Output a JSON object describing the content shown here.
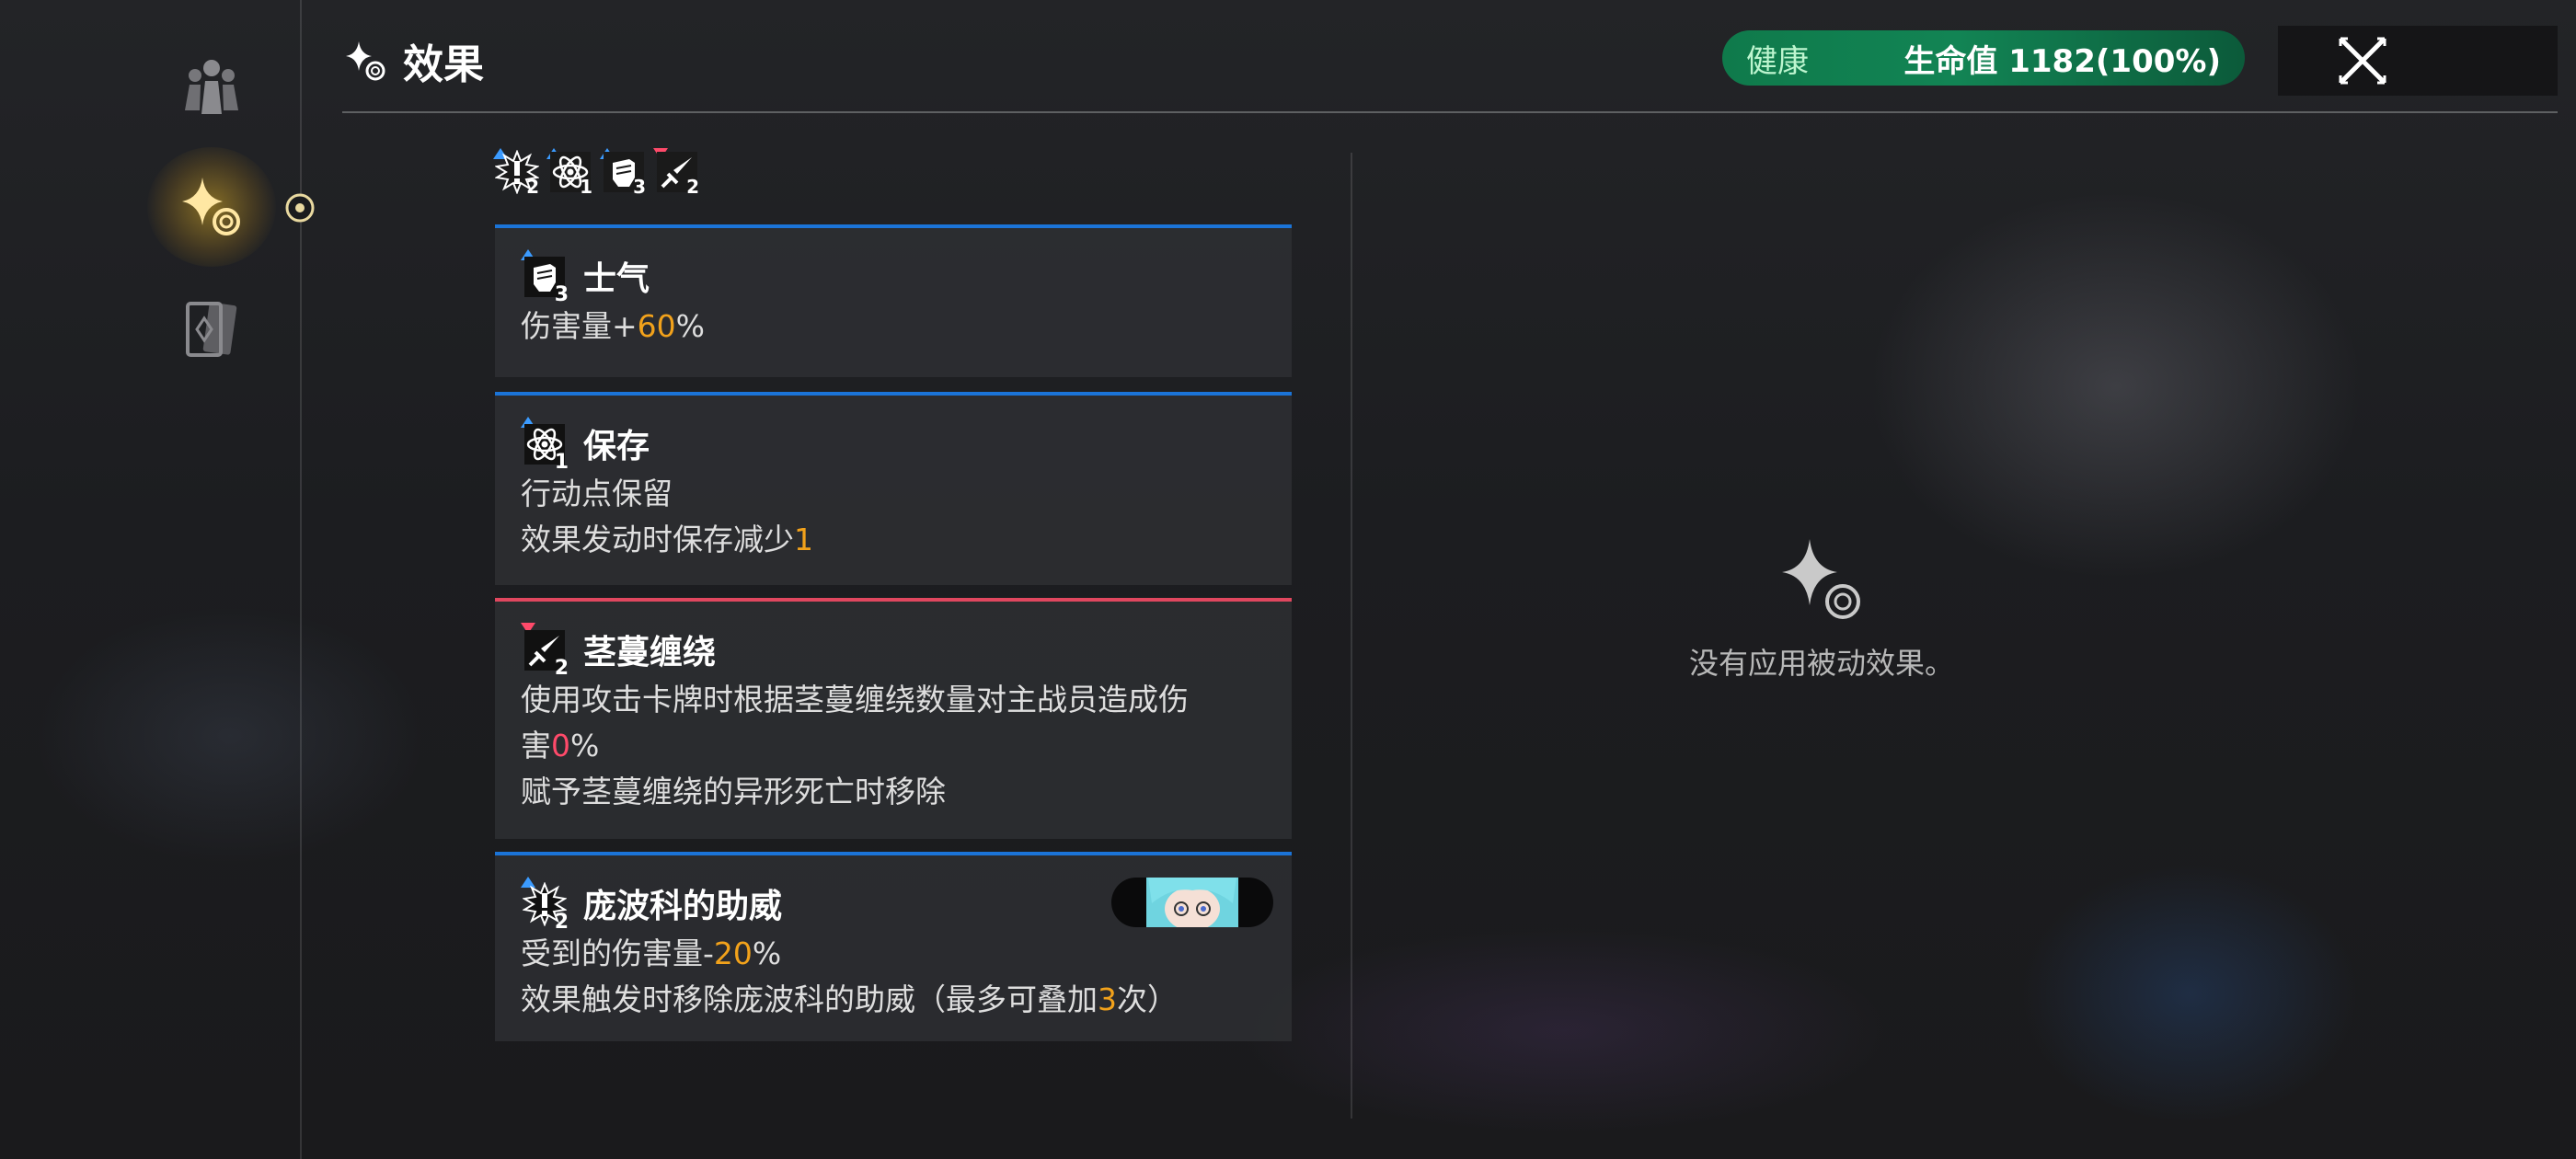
{
  "header": {
    "title": "效果",
    "title_icon": "sparkle-swirl-icon",
    "health_status": "健康",
    "hp_text": "生命值 1182(100%)",
    "close_icon": "close-x-icon"
  },
  "sidebar": {
    "items": [
      {
        "icon": "party-members-icon"
      },
      {
        "icon": "effects-sparkle-icon",
        "active": true
      },
      {
        "icon": "cards-icon"
      }
    ]
  },
  "summary": [
    {
      "icon": "exclamation-burst-icon",
      "direction": "up",
      "count": "2"
    },
    {
      "icon": "atom-icon",
      "direction": "up",
      "count": "1"
    },
    {
      "icon": "fist-icon",
      "direction": "up",
      "count": "3"
    },
    {
      "icon": "sword-icon",
      "direction": "down",
      "count": "2"
    }
  ],
  "effects": [
    {
      "icon": "fist-icon",
      "direction": "up",
      "count": "3",
      "title": "士气",
      "l1_a": "伤害量+",
      "l1_b": "60",
      "l1_c": "%"
    },
    {
      "icon": "atom-icon",
      "direction": "up",
      "count": "1",
      "title": "保存",
      "l1": "行动点保留",
      "l2_a": "效果发动时保存减少",
      "l2_b": "1"
    },
    {
      "icon": "sword-icon",
      "direction": "down",
      "count": "2",
      "title": "茎蔓缠绕",
      "l1": "使用攻击卡牌时根据茎蔓缠绕数量对主战员造成伤",
      "l2_a": "害",
      "l2_b": "0",
      "l2_c": "%",
      "l3": "赋予茎蔓缠绕的异形死亡时移除"
    },
    {
      "icon": "exclamation-burst-icon",
      "direction": "up",
      "count": "2",
      "title": "庞波科的助威",
      "l1_a": "受到的伤害量-",
      "l1_b": "20",
      "l1_c": "%",
      "l2_a": "效果触发时移除庞波科的助威（最多可叠加",
      "l2_b": "3",
      "l2_c": "次）"
    }
  ],
  "passive": {
    "icon": "sparkle-swirl-icon",
    "empty_text": "没有应用被动效果。"
  },
  "colors": {
    "buff": "#1b74d8",
    "debuff": "#e0475f",
    "highlight": "#f2a21b",
    "health": "#128454"
  }
}
